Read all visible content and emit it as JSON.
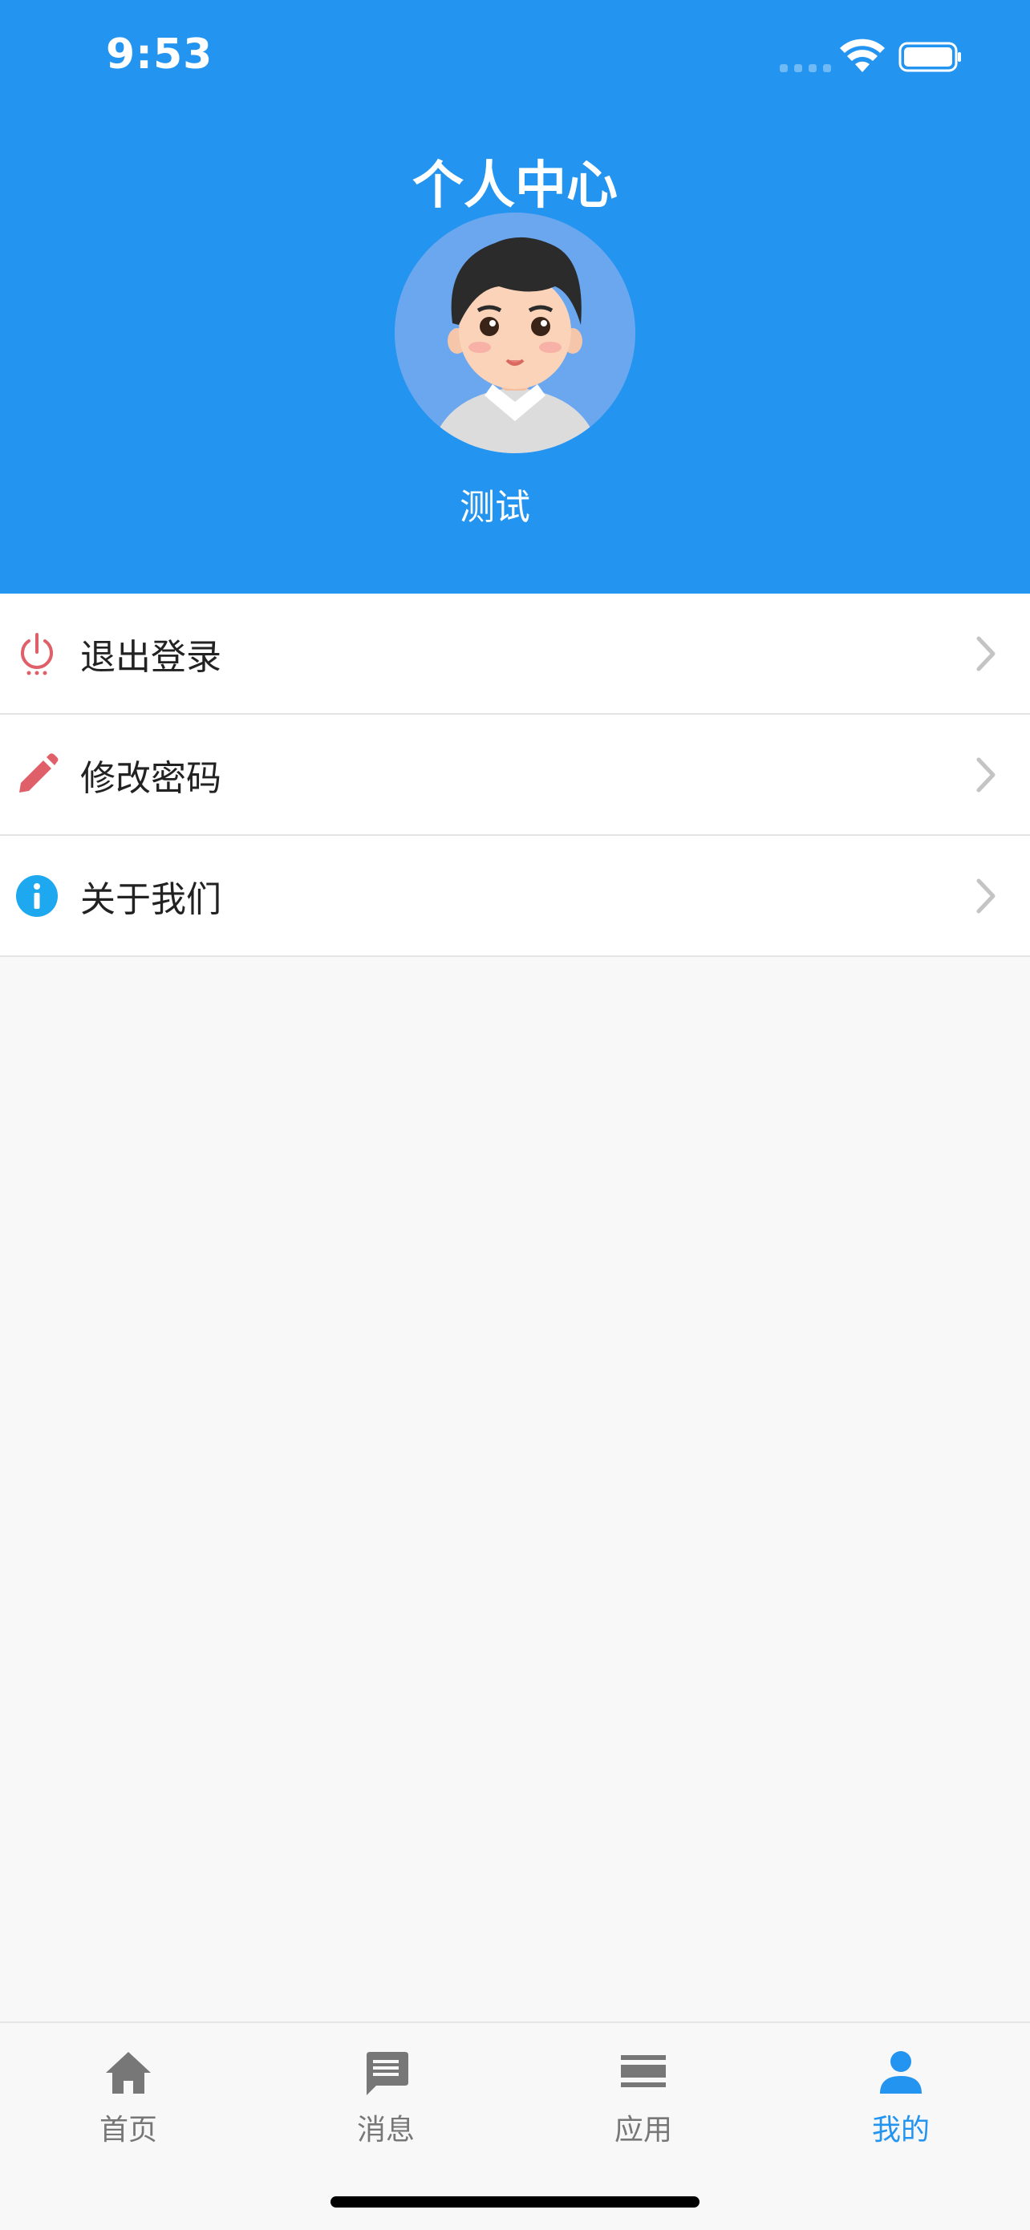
{
  "status_bar": {
    "time": "9:53"
  },
  "header": {
    "title": "个人中心",
    "username": "测试"
  },
  "menu": {
    "items": [
      {
        "label": "退出登录",
        "icon": "power-icon"
      },
      {
        "label": "修改密码",
        "icon": "pencil-icon"
      },
      {
        "label": "关于我们",
        "icon": "info-icon"
      }
    ]
  },
  "tabbar": {
    "tabs": [
      {
        "label": "首页",
        "icon": "home-icon"
      },
      {
        "label": "消息",
        "icon": "message-icon"
      },
      {
        "label": "应用",
        "icon": "apps-icon"
      },
      {
        "label": "我的",
        "icon": "person-icon"
      }
    ],
    "active_index": 3
  },
  "colors": {
    "primary": "#2394f0",
    "danger": "#e0606a",
    "info": "#1ea8f0",
    "tab_inactive": "#777777"
  }
}
